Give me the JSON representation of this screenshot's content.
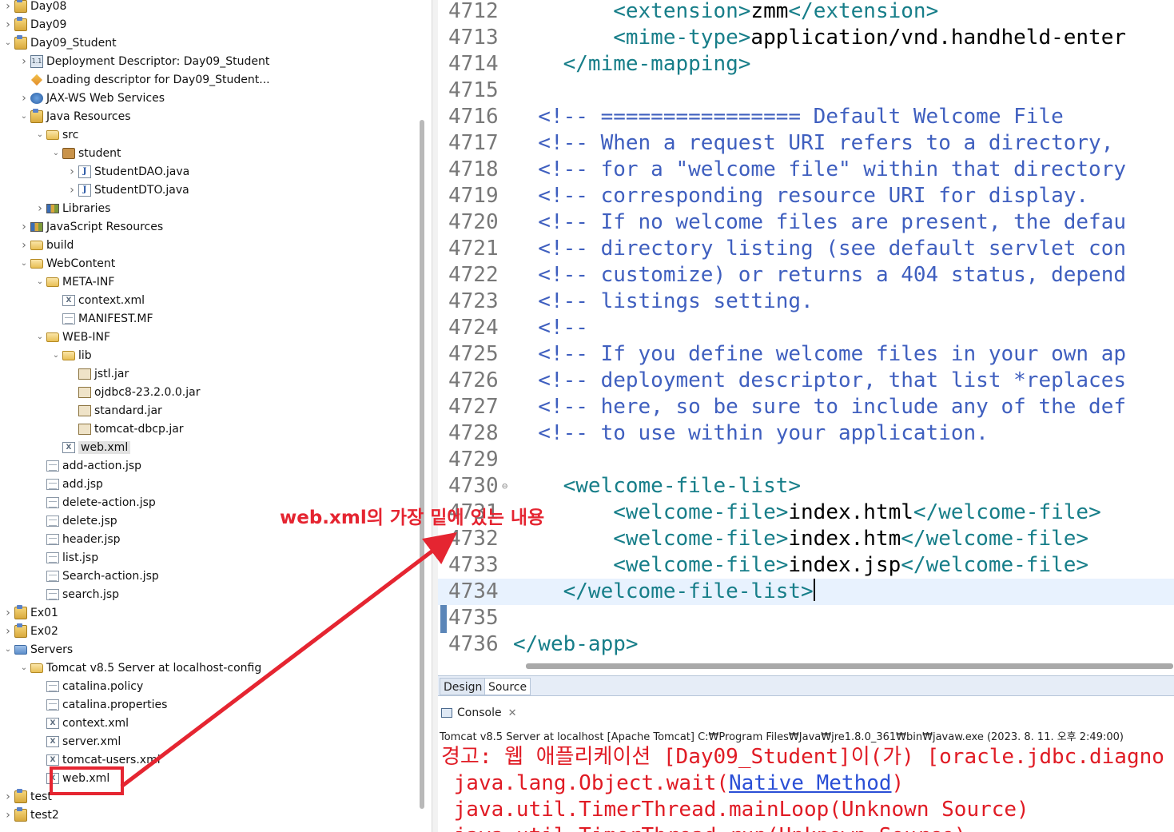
{
  "explorer": {
    "items": [
      {
        "label": "Day08",
        "icon": "project",
        "depth": 0,
        "twisty": "collapsed"
      },
      {
        "label": "Day09",
        "icon": "project",
        "depth": 0,
        "twisty": "collapsed"
      },
      {
        "label": "Day09_Student",
        "icon": "project",
        "depth": 0,
        "twisty": "expanded"
      },
      {
        "label": "Deployment Descriptor: Day09_Student",
        "icon": "dd",
        "depth": 1,
        "twisty": "collapsed"
      },
      {
        "label": "Loading descriptor for Day09_Student...",
        "icon": "loading",
        "depth": 1,
        "twisty": ""
      },
      {
        "label": "JAX-WS Web Services",
        "icon": "ws",
        "depth": 1,
        "twisty": "collapsed"
      },
      {
        "label": "Java Resources",
        "icon": "project",
        "depth": 1,
        "twisty": "expanded"
      },
      {
        "label": "src",
        "icon": "folder",
        "depth": 2,
        "twisty": "expanded"
      },
      {
        "label": "student",
        "icon": "package",
        "depth": 3,
        "twisty": "expanded"
      },
      {
        "label": "StudentDAO.java",
        "icon": "java",
        "depth": 4,
        "twisty": "collapsed"
      },
      {
        "label": "StudentDTO.java",
        "icon": "java",
        "depth": 4,
        "twisty": "collapsed"
      },
      {
        "label": "Libraries",
        "icon": "lib",
        "depth": 2,
        "twisty": "collapsed"
      },
      {
        "label": "JavaScript Resources",
        "icon": "lib",
        "depth": 1,
        "twisty": "collapsed"
      },
      {
        "label": "build",
        "icon": "folder",
        "depth": 1,
        "twisty": "collapsed"
      },
      {
        "label": "WebContent",
        "icon": "folder",
        "depth": 1,
        "twisty": "expanded"
      },
      {
        "label": "META-INF",
        "icon": "folder",
        "depth": 2,
        "twisty": "expanded"
      },
      {
        "label": "context.xml",
        "icon": "xml",
        "depth": 3,
        "twisty": ""
      },
      {
        "label": "MANIFEST.MF",
        "icon": "file",
        "depth": 3,
        "twisty": ""
      },
      {
        "label": "WEB-INF",
        "icon": "folder",
        "depth": 2,
        "twisty": "expanded"
      },
      {
        "label": "lib",
        "icon": "folder",
        "depth": 3,
        "twisty": "expanded"
      },
      {
        "label": "jstl.jar",
        "icon": "jar",
        "depth": 4,
        "twisty": ""
      },
      {
        "label": "ojdbc8-23.2.0.0.jar",
        "icon": "jar",
        "depth": 4,
        "twisty": ""
      },
      {
        "label": "standard.jar",
        "icon": "jar",
        "depth": 4,
        "twisty": ""
      },
      {
        "label": "tomcat-dbcp.jar",
        "icon": "jar",
        "depth": 4,
        "twisty": ""
      },
      {
        "label": "web.xml",
        "icon": "xml",
        "depth": 3,
        "twisty": "",
        "selected": true
      },
      {
        "label": "add-action.jsp",
        "icon": "file",
        "depth": 2,
        "twisty": ""
      },
      {
        "label": "add.jsp",
        "icon": "file",
        "depth": 2,
        "twisty": ""
      },
      {
        "label": "delete-action.jsp",
        "icon": "file",
        "depth": 2,
        "twisty": ""
      },
      {
        "label": "delete.jsp",
        "icon": "file",
        "depth": 2,
        "twisty": ""
      },
      {
        "label": "header.jsp",
        "icon": "file",
        "depth": 2,
        "twisty": ""
      },
      {
        "label": "list.jsp",
        "icon": "file",
        "depth": 2,
        "twisty": ""
      },
      {
        "label": "Search-action.jsp",
        "icon": "file",
        "depth": 2,
        "twisty": ""
      },
      {
        "label": "search.jsp",
        "icon": "file",
        "depth": 2,
        "twisty": ""
      },
      {
        "label": "Ex01",
        "icon": "project",
        "depth": 0,
        "twisty": "collapsed"
      },
      {
        "label": "Ex02",
        "icon": "project",
        "depth": 0,
        "twisty": "collapsed"
      },
      {
        "label": "Servers",
        "icon": "servers",
        "depth": 0,
        "twisty": "expanded"
      },
      {
        "label": "Tomcat v8.5 Server at localhost-config",
        "icon": "folder",
        "depth": 1,
        "twisty": "expanded"
      },
      {
        "label": "catalina.policy",
        "icon": "file",
        "depth": 2,
        "twisty": ""
      },
      {
        "label": "catalina.properties",
        "icon": "file",
        "depth": 2,
        "twisty": ""
      },
      {
        "label": "context.xml",
        "icon": "xml",
        "depth": 2,
        "twisty": ""
      },
      {
        "label": "server.xml",
        "icon": "xml",
        "depth": 2,
        "twisty": ""
      },
      {
        "label": "tomcat-users.xml",
        "icon": "xml",
        "depth": 2,
        "twisty": ""
      },
      {
        "label": "web.xml",
        "icon": "xml",
        "depth": 2,
        "twisty": ""
      },
      {
        "label": "test",
        "icon": "project",
        "depth": 0,
        "twisty": "collapsed"
      },
      {
        "label": "test2",
        "icon": "project",
        "depth": 0,
        "twisty": "collapsed"
      }
    ]
  },
  "editor": {
    "lines": [
      {
        "num": "4712",
        "parts": [
          {
            "t": "tag",
            "s": "        <extension>"
          },
          {
            "t": "txt",
            "s": "zmm"
          },
          {
            "t": "tag",
            "s": "</extension>"
          }
        ]
      },
      {
        "num": "4713",
        "parts": [
          {
            "t": "tag",
            "s": "        <mime-type>"
          },
          {
            "t": "txt",
            "s": "application/vnd.handheld-enter"
          }
        ]
      },
      {
        "num": "4714",
        "parts": [
          {
            "t": "tag",
            "s": "    </mime-mapping>"
          }
        ]
      },
      {
        "num": "4715",
        "parts": []
      },
      {
        "num": "4716",
        "parts": [
          {
            "t": "cmt",
            "s": "  <!-- ================ Default Welcome File"
          }
        ]
      },
      {
        "num": "4717",
        "parts": [
          {
            "t": "cmt",
            "s": "  <!-- When a request URI refers to a directory,"
          }
        ]
      },
      {
        "num": "4718",
        "parts": [
          {
            "t": "cmt",
            "s": "  <!-- for a \"welcome file\" within that directory"
          }
        ]
      },
      {
        "num": "4719",
        "parts": [
          {
            "t": "cmt",
            "s": "  <!-- corresponding resource URI for display."
          }
        ]
      },
      {
        "num": "4720",
        "parts": [
          {
            "t": "cmt",
            "s": "  <!-- If no welcome files are present, the defau"
          }
        ]
      },
      {
        "num": "4721",
        "parts": [
          {
            "t": "cmt",
            "s": "  <!-- directory listing (see default servlet con"
          }
        ]
      },
      {
        "num": "4722",
        "parts": [
          {
            "t": "cmt",
            "s": "  <!-- customize) or returns a 404 status, depend"
          }
        ]
      },
      {
        "num": "4723",
        "parts": [
          {
            "t": "cmt",
            "s": "  <!-- listings setting."
          }
        ]
      },
      {
        "num": "4724",
        "parts": [
          {
            "t": "cmt",
            "s": "  <!--"
          }
        ]
      },
      {
        "num": "4725",
        "parts": [
          {
            "t": "cmt",
            "s": "  <!-- If you define welcome files in your own ap"
          }
        ]
      },
      {
        "num": "4726",
        "parts": [
          {
            "t": "cmt",
            "s": "  <!-- deployment descriptor, that list *replaces"
          }
        ]
      },
      {
        "num": "4727",
        "parts": [
          {
            "t": "cmt",
            "s": "  <!-- here, so be sure to include any of the def"
          }
        ]
      },
      {
        "num": "4728",
        "parts": [
          {
            "t": "cmt",
            "s": "  <!-- to use within your application."
          }
        ]
      },
      {
        "num": "4729",
        "parts": []
      },
      {
        "num": "4730",
        "fold": true,
        "parts": [
          {
            "t": "tag",
            "s": "    <welcome-file-list>"
          }
        ]
      },
      {
        "num": "4731",
        "parts": [
          {
            "t": "tag",
            "s": "        <welcome-file>"
          },
          {
            "t": "txt",
            "s": "index.html"
          },
          {
            "t": "tag",
            "s": "</welcome-file>"
          }
        ]
      },
      {
        "num": "4732",
        "parts": [
          {
            "t": "tag",
            "s": "        <welcome-file>"
          },
          {
            "t": "txt",
            "s": "index.htm"
          },
          {
            "t": "tag",
            "s": "</welcome-file>"
          }
        ]
      },
      {
        "num": "4733",
        "parts": [
          {
            "t": "tag",
            "s": "        <welcome-file>"
          },
          {
            "t": "txt",
            "s": "index.jsp"
          },
          {
            "t": "tag",
            "s": "</welcome-file>"
          }
        ]
      },
      {
        "num": "4734",
        "current": true,
        "parts": [
          {
            "t": "tag",
            "s": "    </welcome-file-list>"
          }
        ]
      },
      {
        "num": "4735",
        "parts": []
      },
      {
        "num": "4736",
        "parts": [
          {
            "t": "tag",
            "s": "</web-app>"
          }
        ]
      }
    ],
    "tabs": {
      "design": "Design",
      "source": "Source"
    }
  },
  "console": {
    "tab_label": "Console",
    "close_glyph": "✕",
    "status": "Tomcat v8.5 Server at localhost [Apache Tomcat] C:₩Program Files₩Java₩jre1.8.0_361₩bin₩javaw.exe (2023. 8. 11. 오후 2:49:00)",
    "line1": "경고: 웹 애플리케이션 [Day09_Student]이(가) [oracle.jdbc.diagno",
    "line2_prefix": " java.lang.Object.wait(",
    "line2_link": "Native Method",
    "line2_suffix": ")",
    "line3": " java.util.TimerThread.mainLoop(Unknown Source)",
    "line4": " java.util.TimerThread.run(Unknown Source)"
  },
  "annotation": {
    "text": "web.xml의 가장 밑에 있는 내용",
    "color": "#e52531"
  }
}
